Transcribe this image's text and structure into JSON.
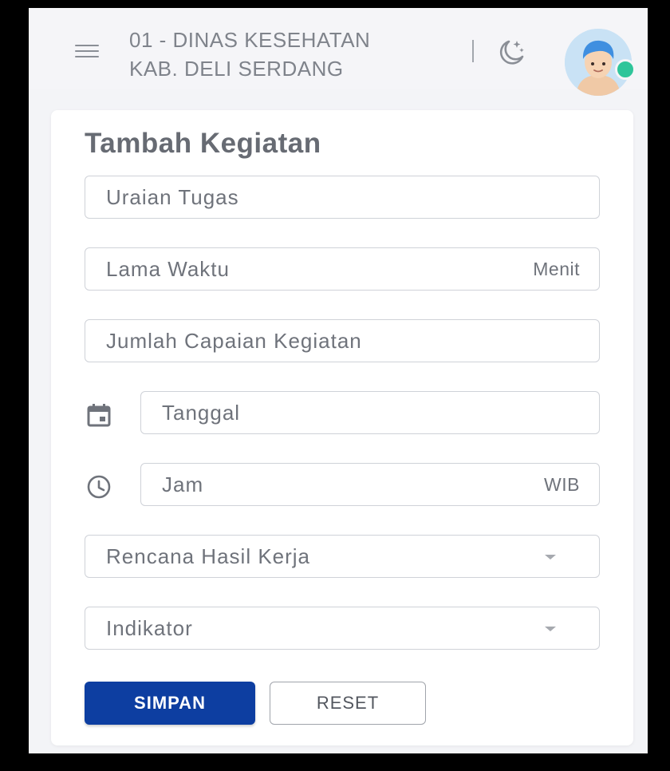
{
  "header": {
    "org_name": "01 - DINAS KESEHATAN\nKAB. DELI SERDANG",
    "menu_icon": "hamburger-menu-icon",
    "theme_icon": "moon-stars-icon",
    "avatar": "user-avatar",
    "status_color": "#2fc59a"
  },
  "form": {
    "title": "Tambah Kegiatan",
    "fields": {
      "uraian_tugas": {
        "label": "Uraian Tugas"
      },
      "lama_waktu": {
        "label": "Lama Waktu",
        "suffix": "Menit"
      },
      "jumlah_capaian": {
        "label": "Jumlah Capaian Kegiatan"
      },
      "tanggal": {
        "label": "Tanggal",
        "icon": "calendar-icon"
      },
      "jam": {
        "label": "Jam",
        "suffix": "WIB",
        "icon": "clock-icon"
      },
      "rencana_hasil_kerja": {
        "label": "Rencana Hasil Kerja",
        "type": "select"
      },
      "indikator": {
        "label": "Indikator",
        "type": "select"
      }
    },
    "buttons": {
      "save": "SIMPAN",
      "reset": "RESET"
    }
  },
  "colors": {
    "primary": "#0d3ea1",
    "background": "#f3f4f7",
    "card": "#ffffff",
    "text_muted": "#6f737b"
  }
}
